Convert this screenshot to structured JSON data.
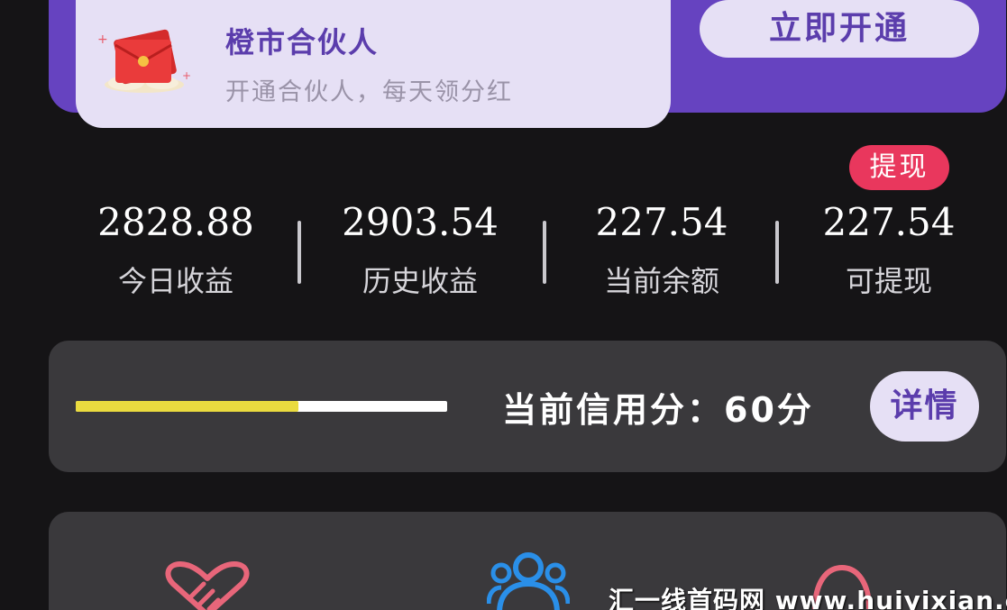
{
  "partner": {
    "title": "橙市合伙人",
    "subtitle": "开通合伙人，每天领分红",
    "activate_label": "立即开通"
  },
  "withdraw_badge": "提现",
  "stats": [
    {
      "value": "2828.88",
      "label": "今日收益"
    },
    {
      "value": "2903.54",
      "label": "历史收益"
    },
    {
      "value": "227.54",
      "label": "当前余额"
    },
    {
      "value": "227.54",
      "label": "可提现"
    }
  ],
  "credit": {
    "label": "当前信用分：60分",
    "score_fraction": 0.6,
    "details_label": "详情"
  },
  "colors": {
    "accent_purple": "#6643c0",
    "card_lavender": "#e6e0f5",
    "badge_red": "#e9375d",
    "bar_yellow": "#eadb3f"
  },
  "icons": [
    "envelope-icon",
    "heart-handshake-icon",
    "users-icon",
    "headset-icon"
  ],
  "watermark": "汇一线首码网 www.huiyixian.com"
}
